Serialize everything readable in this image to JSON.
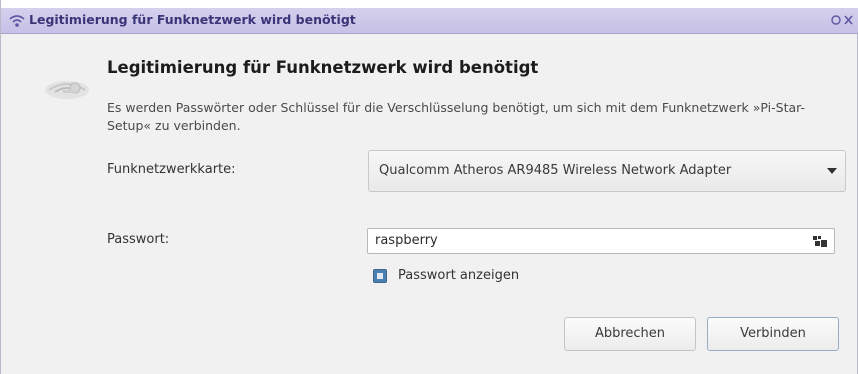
{
  "window": {
    "title": "Legitimierung für Funknetzwerk wird benötigt",
    "title_icon": "wifi-lock-icon",
    "controls_icon": "window-controls-icon"
  },
  "dialog": {
    "icon": "wireless-network-icon",
    "heading": "Legitimierung für Funknetzwerk wird benötigt",
    "description": "Es werden Passwörter oder Schlüssel für die Verschlüsselung benötigt, um sich mit dem Funknetzwerk »Pi-Star-Setup« zu verbinden."
  },
  "adapter": {
    "label": "Funknetzwerkkarte:",
    "selected": "Qualcomm Atheros AR9485 Wireless Network Adapter"
  },
  "password": {
    "label": "Passwort:",
    "value": "raspberry",
    "keyboard_icon": "keyboard-icon"
  },
  "show_password": {
    "label": "Passwort anzeigen",
    "checked": true
  },
  "buttons": {
    "cancel": "Abbrechen",
    "connect": "Verbinden"
  },
  "colors": {
    "titlebar": "#c9c4e8",
    "title_text": "#3a3578",
    "checkbox": "#4c7fb4"
  }
}
